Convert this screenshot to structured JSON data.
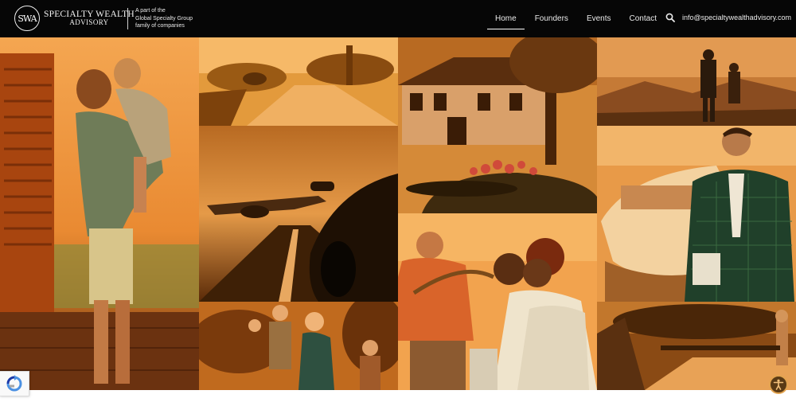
{
  "header": {
    "logo_monogram": "SWA",
    "logo_line1": "SPECIALTY WEALTH",
    "logo_line2": "ADVISORY",
    "tagline": [
      "A part of the",
      "Global Specialty Group",
      "family of companies"
    ],
    "nav": [
      {
        "label": "Home",
        "active": true
      },
      {
        "label": "Founders",
        "active": false
      },
      {
        "label": "Events",
        "active": false
      },
      {
        "label": "Contact",
        "active": false
      }
    ],
    "email": "info@specialtywealthadvisory.com",
    "search_icon": "search-icon"
  },
  "colors": {
    "header_bg": "#060606",
    "tint_light": "#f0a048",
    "tint_mid": "#c86a1c",
    "tint_dark": "#5a2e08",
    "a11y_bg": "#5a3a15"
  },
  "badges": {
    "recaptcha_icon": "recaptcha-icon",
    "accessibility_icon": "accessibility-icon"
  }
}
